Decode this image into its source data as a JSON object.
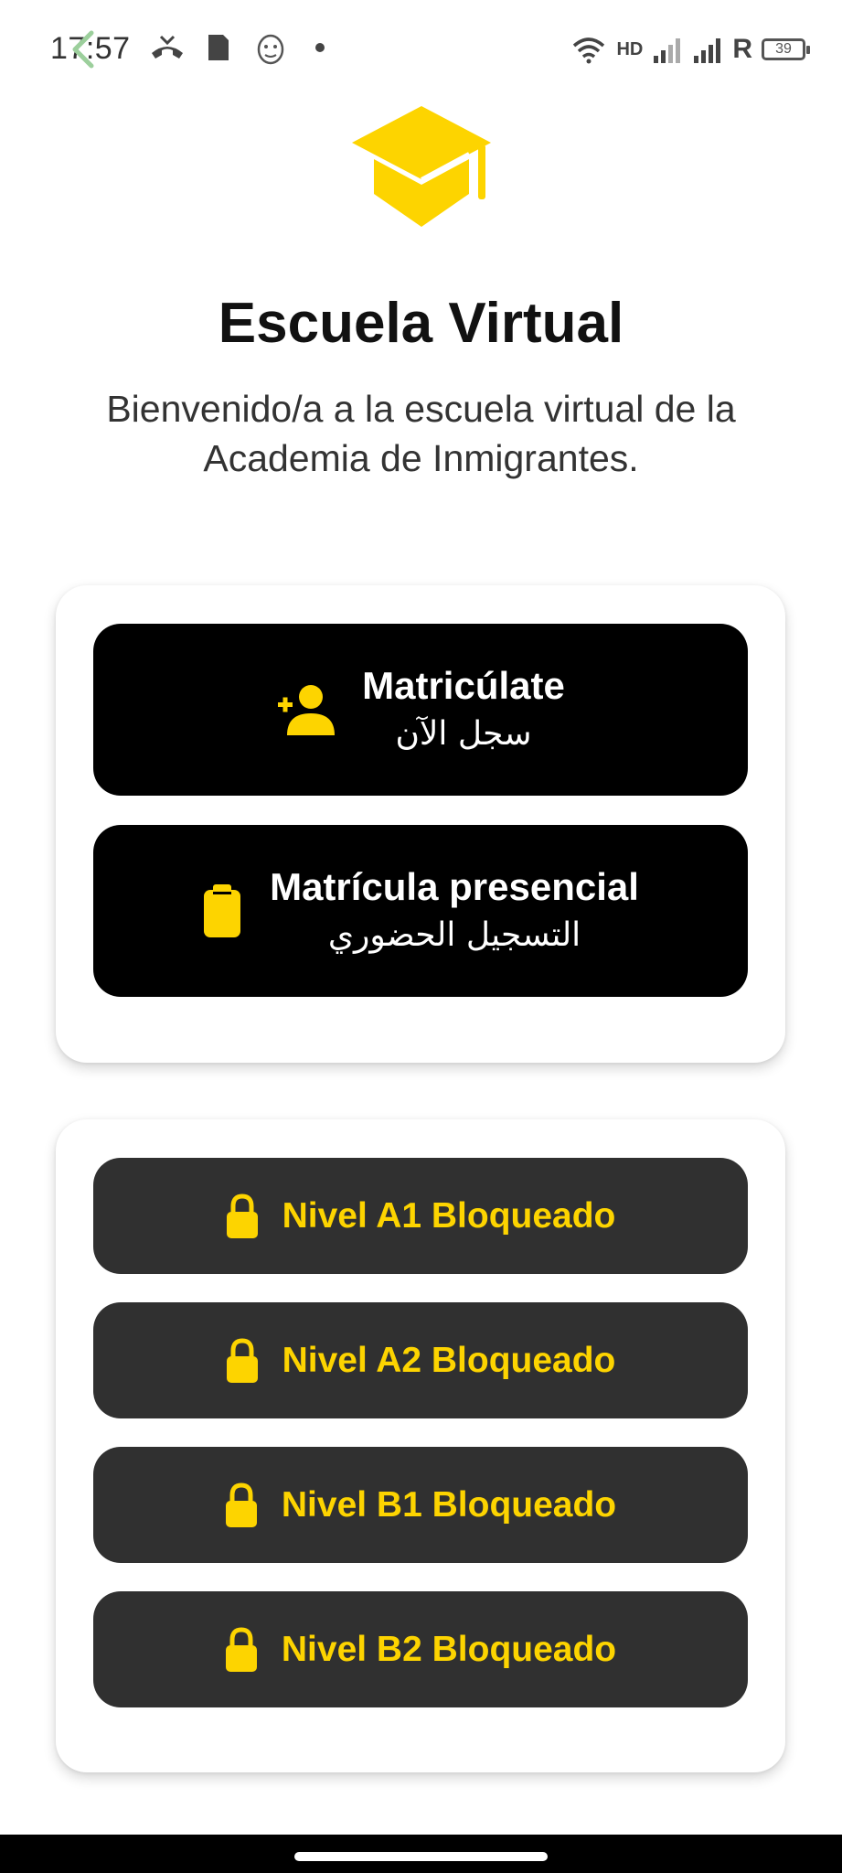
{
  "status_bar": {
    "time": "17:57",
    "network": "HD",
    "carrier_letter": "R",
    "battery": "39",
    "icons": [
      "back-arrow-icon",
      "missed-call-icon",
      "sim-card-icon",
      "lion-app-icon",
      "dot-icon",
      "wifi-icon",
      "signal-icon",
      "signal-icon",
      "battery-icon"
    ]
  },
  "header": {
    "logo": "graduation-cap-icon",
    "title": "Escuela Virtual",
    "subtitle": "Bienvenido/a a la escuela virtual de la Academia de Inmigrantes."
  },
  "enroll": {
    "online": {
      "label": "Matricúlate",
      "sublabel": "سجل الآن",
      "icon": "add-user-icon"
    },
    "in_person": {
      "label": "Matrícula presencial",
      "sublabel": "التسجيل الحضوري",
      "icon": "clipboard-icon"
    }
  },
  "levels": [
    {
      "label": "Nivel A1 Bloqueado",
      "icon": "lock-icon"
    },
    {
      "label": "Nivel A2 Bloqueado",
      "icon": "lock-icon"
    },
    {
      "label": "Nivel B1 Bloqueado",
      "icon": "lock-icon"
    },
    {
      "label": "Nivel B2 Bloqueado",
      "icon": "lock-icon"
    }
  ],
  "colors": {
    "accent": "#fdd400",
    "primary_button": "#000000",
    "locked_button": "#303030",
    "background": "#ffffff"
  }
}
